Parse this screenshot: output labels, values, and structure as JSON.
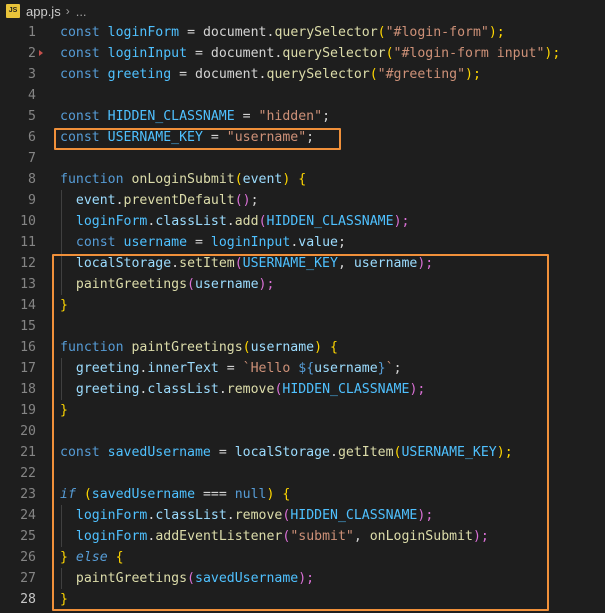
{
  "file": {
    "name": "app.js",
    "icon": "JS",
    "more": "..."
  },
  "line_numbers": [
    "1",
    "2",
    "3",
    "4",
    "5",
    "6",
    "7",
    "8",
    "9",
    "10",
    "11",
    "12",
    "13",
    "14",
    "15",
    "16",
    "17",
    "18",
    "19",
    "20",
    "21",
    "22",
    "23",
    "24",
    "25",
    "26",
    "27",
    "28"
  ],
  "code": {
    "l1": [
      "const",
      " ",
      "loginForm",
      " = ",
      "document",
      ".",
      "querySelector",
      "(",
      "\"#login-form\"",
      ");"
    ],
    "l2": [
      "const",
      " ",
      "loginInput",
      " = ",
      "document",
      ".",
      "querySelector",
      "(",
      "\"#login-form input\"",
      ");"
    ],
    "l3": [
      "const",
      " ",
      "greeting",
      " = ",
      "document",
      ".",
      "querySelector",
      "(",
      "\"#greeting\"",
      ");"
    ],
    "l5": [
      "const",
      " ",
      "HIDDEN_CLASSNAME",
      " = ",
      "\"hidden\"",
      ";"
    ],
    "l6": [
      "const",
      " ",
      "USERNAME_KEY",
      " = ",
      "\"username\"",
      ";"
    ],
    "l8": [
      "function",
      " ",
      "onLoginSubmit",
      "(",
      "event",
      ")",
      " ",
      "{"
    ],
    "l9": [
      "  ",
      "event",
      ".",
      "preventDefault",
      "()",
      ";"
    ],
    "l10": [
      "  ",
      "loginForm",
      ".",
      "classList",
      ".",
      "add",
      "(",
      "HIDDEN_CLASSNAME",
      ");"
    ],
    "l11": [
      "  ",
      "const",
      " ",
      "username",
      " = ",
      "loginInput",
      ".",
      "value",
      ";"
    ],
    "l12": [
      "  ",
      "localStorage",
      ".",
      "setItem",
      "(",
      "USERNAME_KEY",
      ", ",
      "username",
      ");"
    ],
    "l13": [
      "  ",
      "paintGreetings",
      "(",
      "username",
      ");"
    ],
    "l14": [
      "}"
    ],
    "l16": [
      "function",
      " ",
      "paintGreetings",
      "(",
      "username",
      ")",
      " ",
      "{"
    ],
    "l17": [
      "  ",
      "greeting",
      ".",
      "innerText",
      " = ",
      "`Hello ",
      "${",
      "username",
      "}",
      "`",
      ";"
    ],
    "l18": [
      "  ",
      "greeting",
      ".",
      "classList",
      ".",
      "remove",
      "(",
      "HIDDEN_CLASSNAME",
      ");"
    ],
    "l19": [
      "}"
    ],
    "l21": [
      "const",
      " ",
      "savedUsername",
      " = ",
      "localStorage",
      ".",
      "getItem",
      "(",
      "USERNAME_KEY",
      ");"
    ],
    "l23": [
      "if",
      " ",
      "(",
      "savedUsername",
      " === ",
      "null",
      ")",
      " ",
      "{"
    ],
    "l24": [
      "  ",
      "loginForm",
      ".",
      "classList",
      ".",
      "remove",
      "(",
      "HIDDEN_CLASSNAME",
      ");"
    ],
    "l25": [
      "  ",
      "loginForm",
      ".",
      "addEventListener",
      "(",
      "\"submit\"",
      ", ",
      "onLoginSubmit",
      ");"
    ],
    "l26": [
      "}",
      " ",
      "else",
      " ",
      "{"
    ],
    "l27": [
      "  ",
      "paintGreetings",
      "(",
      "savedUsername",
      ");"
    ],
    "l28": [
      "}"
    ]
  },
  "colors": {
    "background": "#1e1e1e",
    "highlight_box": "#f0903a",
    "keyword": "#569cd6",
    "function": "#dcdcaa",
    "string": "#ce9178",
    "constant": "#4fc1ff",
    "property": "#9cdcfe"
  }
}
